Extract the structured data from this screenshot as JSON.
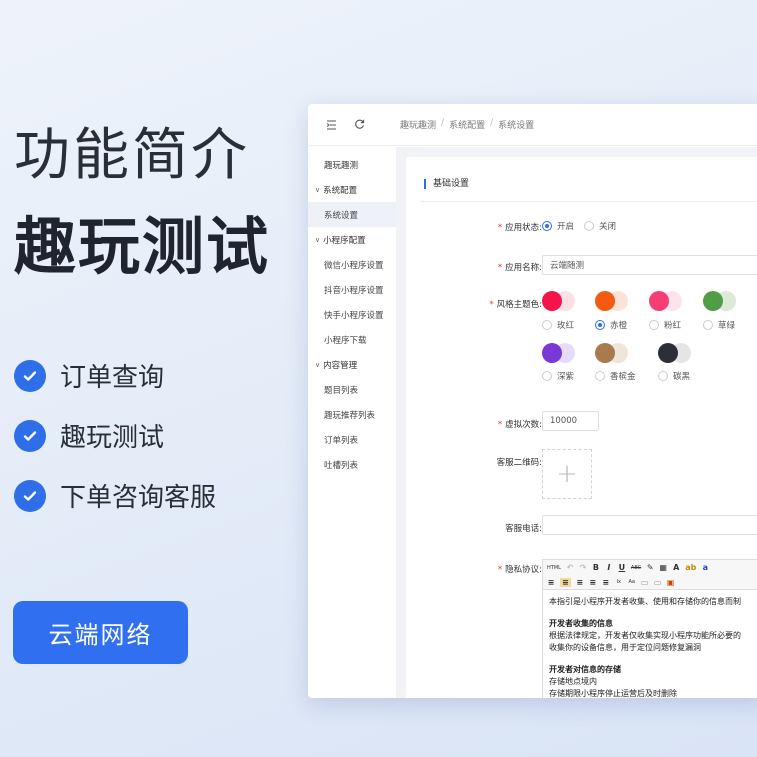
{
  "hero": {
    "title_line1": "功能简介",
    "title_line2": "趣玩测试",
    "features": [
      "订单查询",
      "趣玩测试",
      "下单咨询客服"
    ],
    "brand_button": "云端网络"
  },
  "topbar": {
    "breadcrumb": [
      "趣玩趣测",
      "系统配置",
      "系统设置"
    ]
  },
  "sidebar": {
    "items": [
      {
        "label": "趣玩趣测",
        "kind": "item"
      },
      {
        "label": "系统配置",
        "kind": "group"
      },
      {
        "label": "系统设置",
        "kind": "sub",
        "active": true
      },
      {
        "label": "小程序配置",
        "kind": "group"
      },
      {
        "label": "微信小程序设置",
        "kind": "sub"
      },
      {
        "label": "抖音小程序设置",
        "kind": "sub"
      },
      {
        "label": "快手小程序设置",
        "kind": "sub"
      },
      {
        "label": "小程序下载",
        "kind": "sub"
      },
      {
        "label": "内容管理",
        "kind": "group"
      },
      {
        "label": "题目列表",
        "kind": "sub"
      },
      {
        "label": "趣玩推荐列表",
        "kind": "sub"
      },
      {
        "label": "订单列表",
        "kind": "sub"
      },
      {
        "label": "吐槽列表",
        "kind": "sub"
      }
    ]
  },
  "form": {
    "section_title": "基础设置",
    "app_status": {
      "label": "应用状态:",
      "options": [
        "开启",
        "关闭"
      ],
      "selected": "开启"
    },
    "app_name": {
      "label": "应用名称:",
      "value": "云端随测"
    },
    "theme": {
      "label": "风格主题色:",
      "options": [
        {
          "name": "玫红",
          "colors": [
            "#f5134a",
            "#fde0e6"
          ]
        },
        {
          "name": "赤橙",
          "colors": [
            "#f55a12",
            "#fde3d6"
          ],
          "selected": true
        },
        {
          "name": "粉红",
          "colors": [
            "#f63e74",
            "#fde4ec"
          ]
        },
        {
          "name": "草绿",
          "colors": [
            "#4f9e43",
            "#dcead7"
          ]
        },
        {
          "name": "深紫",
          "colors": [
            "#7a38d6",
            "#e7dcf7"
          ]
        },
        {
          "name": "香槟金",
          "colors": [
            "#a87a4e",
            "#efe5db"
          ]
        },
        {
          "name": "碳黑",
          "colors": [
            "#2d2f38",
            "#e5e5e8"
          ]
        }
      ]
    },
    "virtual_count": {
      "label": "虚拟次数:",
      "value": "10000"
    },
    "qr_code": {
      "label": "客服二维码:"
    },
    "phone": {
      "label": "客服电话:",
      "value": ""
    },
    "privacy": {
      "label": "隐私协议:",
      "toolbar_row1": [
        "HTML",
        "↶",
        "↷",
        "B",
        "I",
        "U",
        "ABC",
        "✎",
        "▦",
        "A",
        "ab",
        "a"
      ],
      "toolbar_row2": [
        "≡",
        "≡",
        "≡",
        "≡",
        "≡",
        "Ix",
        "Aa",
        "▭",
        "▭",
        "▣"
      ],
      "paragraph1": "本指引是小程序开发者收集、使用和存储你的信息而制",
      "heading1": "开发者收集的信息",
      "paragraph2": "根据法律规定，开发者仅收集实现小程序功能所必要的",
      "paragraph3": "收集你的设备信息，用于定位问题修复漏洞",
      "heading2": "开发者对信息的存储",
      "paragraph4": "存储地点境内",
      "paragraph5": "存储期限小程序停止运营后及时删除"
    }
  },
  "colors": {
    "accent": "#2e6ee8",
    "brand": "#2f6ff0"
  }
}
